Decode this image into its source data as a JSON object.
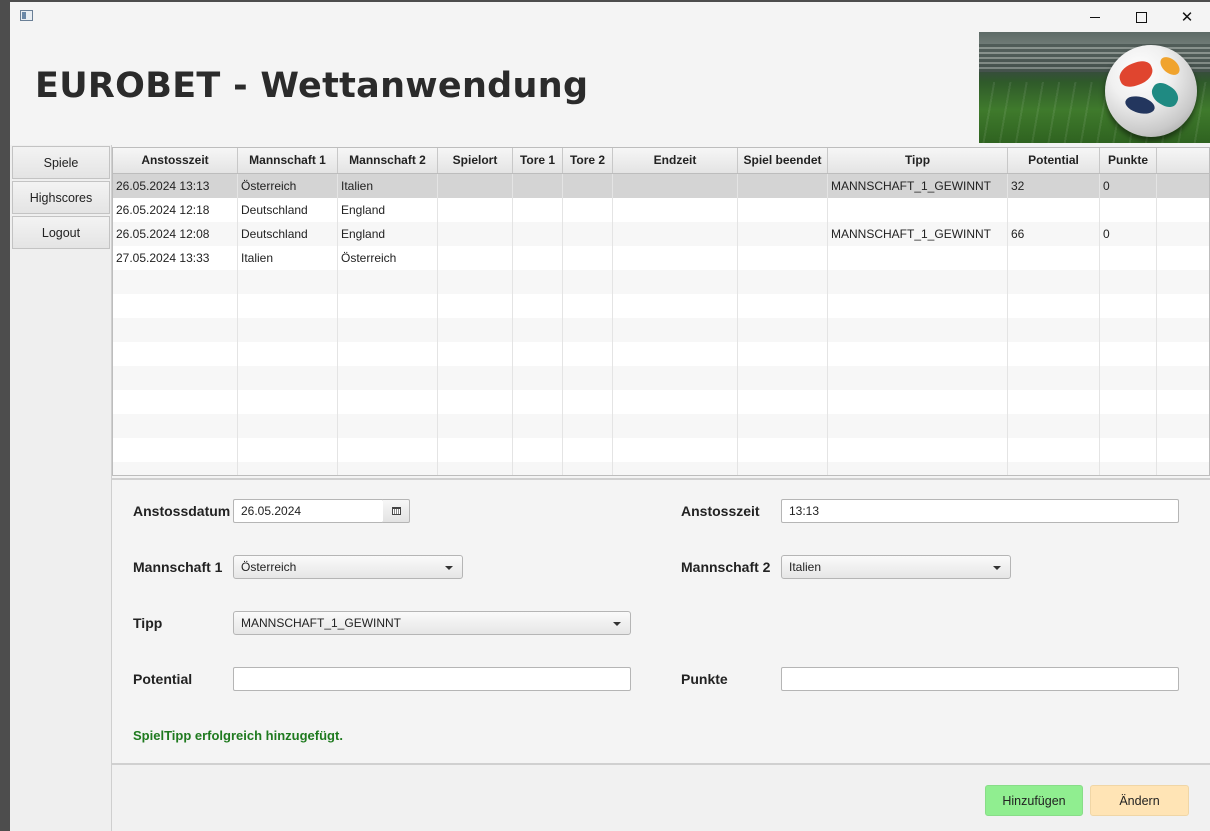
{
  "header": {
    "title": "EUROBET - Wettanwendung"
  },
  "sidebar": {
    "items": [
      {
        "label": "Spiele"
      },
      {
        "label": "Highscores"
      },
      {
        "label": "Logout"
      }
    ]
  },
  "table": {
    "columns": [
      "Anstosszeit",
      "Mannschaft 1",
      "Mannschaft 2",
      "Spielort",
      "Tore 1",
      "Tore 2",
      "Endzeit",
      "Spiel beendet",
      "Tipp",
      "Potential",
      "Punkte"
    ],
    "rows": [
      [
        "26.05.2024 13:13",
        "Österreich",
        "Italien",
        "",
        "",
        "",
        "",
        "",
        "MANNSCHAFT_1_GEWINNT",
        "32",
        "0"
      ],
      [
        "26.05.2024 12:18",
        "Deutschland",
        "England",
        "",
        "",
        "",
        "",
        "",
        "",
        "",
        ""
      ],
      [
        "26.05.2024 12:08",
        "Deutschland",
        "England",
        "",
        "",
        "",
        "",
        "",
        "MANNSCHAFT_1_GEWINNT",
        "66",
        "0"
      ],
      [
        "27.05.2024 13:33",
        "Italien",
        "Österreich",
        "",
        "",
        "",
        "",
        "",
        "",
        "",
        ""
      ]
    ],
    "selected_row": 0
  },
  "form": {
    "anstossdatum_label": "Anstossdatum",
    "anstossdatum_value": "26.05.2024",
    "anstosszeit_label": "Anstosszeit",
    "anstosszeit_value": "13:13",
    "mannschaft1_label": "Mannschaft 1",
    "mannschaft1_value": "Österreich",
    "mannschaft2_label": "Mannschaft 2",
    "mannschaft2_value": "Italien",
    "tipp_label": "Tipp",
    "tipp_value": "MANNSCHAFT_1_GEWINNT",
    "potential_label": "Potential",
    "potential_value": "",
    "punkte_label": "Punkte",
    "punkte_value": "",
    "status_message": "SpielTipp erfolgreich hinzugefügt.",
    "status_color": "#1f7a1f"
  },
  "actions": {
    "add_label": "Hinzufügen",
    "add_color": "#90ee90",
    "edit_label": "Ändern",
    "edit_color": "#ffe4b5"
  },
  "icons": {
    "app": "app-icon",
    "minimize": "minimize-icon",
    "maximize": "maximize-icon",
    "close": "close-icon",
    "calendar": "calendar-icon",
    "dropdown": "chevron-down-icon"
  }
}
